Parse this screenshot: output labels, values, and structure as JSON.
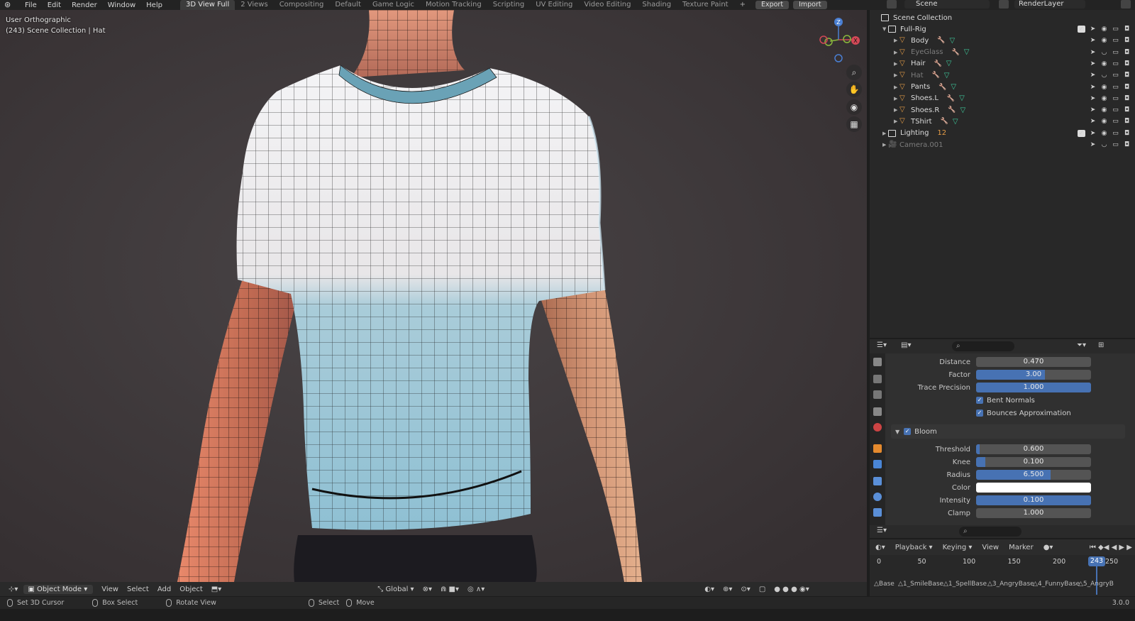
{
  "menu": [
    "File",
    "Edit",
    "Render",
    "Window",
    "Help"
  ],
  "workspaces": [
    "3D View Full",
    "2 Views",
    "Compositing",
    "Default",
    "Game Logic",
    "Motion Tracking",
    "Scripting",
    "UV Editing",
    "Video Editing",
    "Shading",
    "Texture Paint"
  ],
  "active_workspace": "3D View Full",
  "addon_buttons": {
    "export": "Export",
    "import": "Import"
  },
  "scene_name": "Scene",
  "render_layer": "RenderLayer",
  "viewport": {
    "view_label": "User Orthographic",
    "context_label": "(243) Scene Collection | Hat",
    "gizmo": {
      "x": "X",
      "y": "Y",
      "z": "Z"
    }
  },
  "viewport_header": {
    "mode": "Object Mode",
    "menus": [
      "View",
      "Select",
      "Add",
      "Object"
    ],
    "transform": "Global"
  },
  "status_bar": {
    "items": [
      "Set 3D Cursor",
      "Box Select",
      "Rotate View",
      "Select",
      "Move"
    ],
    "version": "3.0.0"
  },
  "outliner": {
    "root": "Scene Collection",
    "rows": [
      {
        "name": "Full-Rig",
        "type": "collection",
        "depth": 0
      },
      {
        "name": "Body",
        "type": "mesh",
        "depth": 1
      },
      {
        "name": "EyeGlass",
        "type": "mesh",
        "depth": 1,
        "dim": true
      },
      {
        "name": "Hair",
        "type": "mesh",
        "depth": 1
      },
      {
        "name": "Hat",
        "type": "mesh",
        "depth": 1,
        "dim": true
      },
      {
        "name": "Pants",
        "type": "mesh",
        "depth": 1
      },
      {
        "name": "Shoes.L",
        "type": "mesh",
        "depth": 1
      },
      {
        "name": "Shoes.R",
        "type": "mesh",
        "depth": 1
      },
      {
        "name": "TShirt",
        "type": "mesh",
        "depth": 1
      },
      {
        "name": "Lighting",
        "type": "collection",
        "depth": 0,
        "badge": "12"
      },
      {
        "name": "Camera.001",
        "type": "camera",
        "depth": 0,
        "dim": true
      }
    ]
  },
  "properties": {
    "rows": [
      {
        "label": "Distance",
        "value": "0.470",
        "fill": 0.0
      },
      {
        "label": "Factor",
        "value": "3.00",
        "fill": 0.6
      },
      {
        "label": "Trace Precision",
        "value": "1.000",
        "fill": 1.0
      }
    ],
    "checkboxes": [
      "Bent Normals",
      "Bounces Approximation"
    ],
    "bloom_title": "Bloom",
    "bloom_rows": [
      {
        "label": "Threshold",
        "value": "0.600",
        "fill": 0.03
      },
      {
        "label": "Knee",
        "value": "0.100",
        "fill": 0.08
      },
      {
        "label": "Radius",
        "value": "6.500",
        "fill": 0.65
      },
      {
        "label": "Color",
        "value": "",
        "color": "#ffffff"
      },
      {
        "label": "Intensity",
        "value": "0.100",
        "fill": 1.0
      },
      {
        "label": "Clamp",
        "value": "1.000",
        "fill": 0.0
      }
    ]
  },
  "timeline": {
    "menus": [
      "Playback",
      "Keying",
      "View",
      "Marker"
    ],
    "ticks": [
      "0",
      "50",
      "100",
      "150",
      "200",
      "250"
    ],
    "current_frame": "243",
    "markers": [
      "Base",
      "1_SmileBase",
      "1_SpellBase",
      "3_AngryBase",
      "4_FunnyBase",
      "5_AngryB"
    ]
  },
  "colors": {
    "accent": "#4772b3",
    "object": "#e59c46",
    "mesh": "#3ec99b",
    "modifier": "#6aa0e8"
  }
}
